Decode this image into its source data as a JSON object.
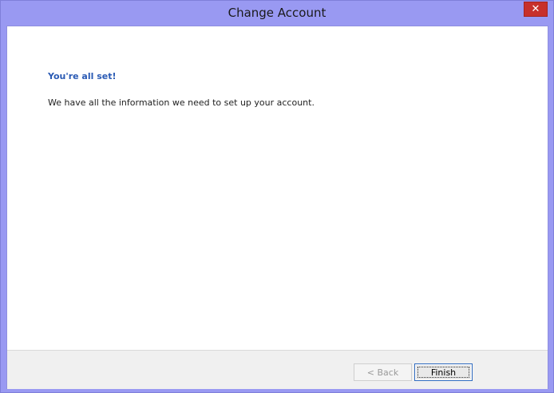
{
  "window": {
    "title": "Change Account",
    "close_glyph": "✕"
  },
  "content": {
    "heading": "You're all set!",
    "message": "We have all the information we need to set up your account."
  },
  "footer": {
    "back_label": "< Back",
    "finish_label": "Finish"
  },
  "colors": {
    "frame": "#9999f2",
    "heading": "#2a5ab4",
    "close": "#c7302b"
  }
}
